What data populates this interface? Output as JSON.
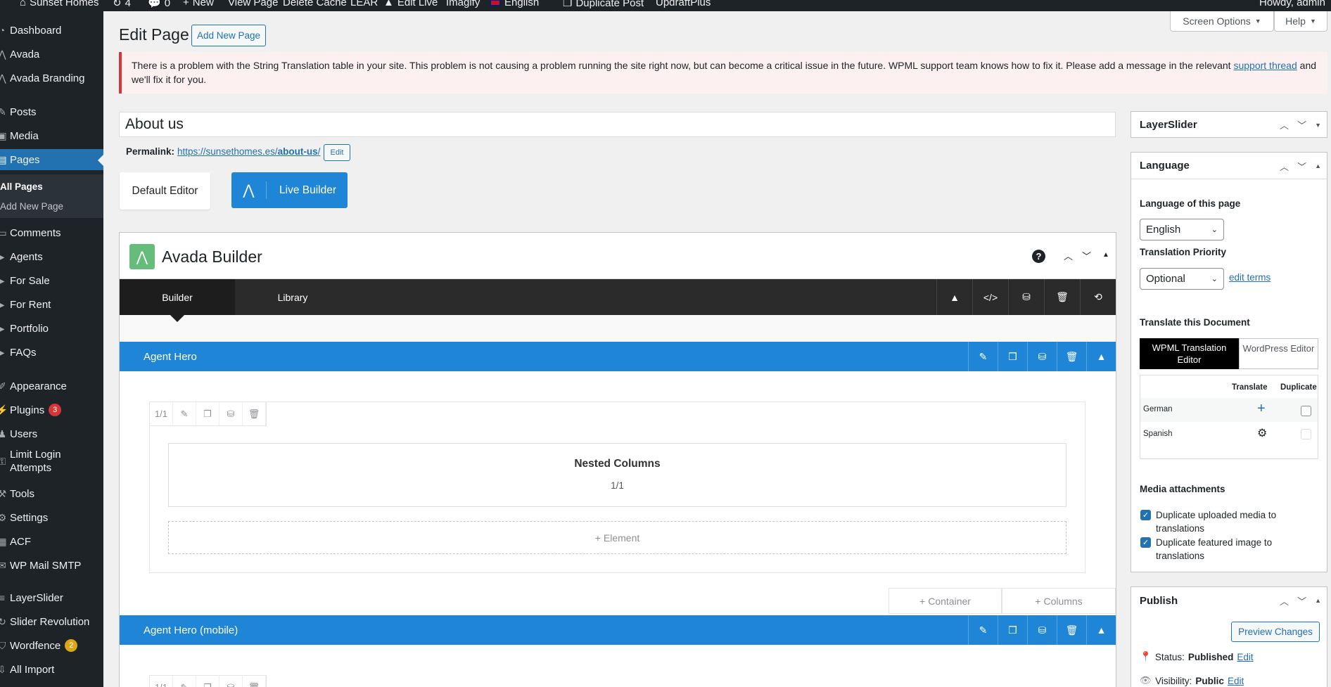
{
  "admin_bar": {
    "site_name": "Sunset Homes",
    "updates": "4",
    "comments": "0",
    "new": "New",
    "view_page": "View Page",
    "delete_cache": "Delete Cache",
    "lear": "LEAR",
    "edit_live": "Edit Live",
    "imagify": "Imagify",
    "language": "English",
    "duplicate_post": "Duplicate Post",
    "updraftplus": "UpdraftPlus",
    "howdy": "Howdy, admin"
  },
  "sidebar": {
    "items": [
      {
        "label": "Dashboard",
        "icon": "dashboard-icon"
      },
      {
        "label": "Avada",
        "icon": "avada-icon"
      },
      {
        "label": "Avada Branding",
        "icon": "avada-icon"
      },
      {
        "label": "Posts",
        "icon": "pin-icon"
      },
      {
        "label": "Media",
        "icon": "media-icon"
      },
      {
        "label": "Pages",
        "icon": "page-icon"
      },
      {
        "label": "Comments",
        "icon": "comment-icon"
      },
      {
        "label": "Agents",
        "icon": "generic-icon"
      },
      {
        "label": "For Sale",
        "icon": "generic-icon"
      },
      {
        "label": "For Rent",
        "icon": "generic-icon"
      },
      {
        "label": "Portfolio",
        "icon": "generic-icon"
      },
      {
        "label": "FAQs",
        "icon": "generic-icon"
      },
      {
        "label": "Appearance",
        "icon": "brush-icon"
      },
      {
        "label": "Plugins",
        "icon": "plugin-icon",
        "badge": "3"
      },
      {
        "label": "Users",
        "icon": "users-icon"
      },
      {
        "label": "Limit Login",
        "label2": "Attempts",
        "icon": "lock-icon"
      },
      {
        "label": "Tools",
        "icon": "wrench-icon"
      },
      {
        "label": "Settings",
        "icon": "settings-icon"
      },
      {
        "label": "ACF",
        "icon": "grid-icon"
      },
      {
        "label": "WP Mail SMTP",
        "icon": "mail-icon"
      },
      {
        "label": "LayerSlider",
        "icon": "layers-icon"
      },
      {
        "label": "Slider Revolution",
        "icon": "refresh-icon"
      },
      {
        "label": "Wordfence",
        "icon": "shield-icon",
        "badge": "2"
      },
      {
        "label": "All Import",
        "icon": "import-icon"
      }
    ],
    "submenu": [
      "All Pages",
      "Add New Page"
    ]
  },
  "top_buttons": {
    "screen_options": "Screen Options",
    "help": "Help"
  },
  "page": {
    "title": "Edit Page",
    "add_new": "Add New Page",
    "post_title": "About us",
    "permalink_label": "Permalink:",
    "permalink_base": "https://sunsethomes.es/",
    "permalink_slug": "about-us",
    "permalink_tail": "/",
    "permalink_edit": "Edit",
    "default_editor": "Default Editor",
    "live_builder": "Live Builder"
  },
  "notice": {
    "text_before": "There is a problem with the String Translation table in your site. This problem is not causing a problem running the site right now, but can become a critical issue in the future. WPML support team knows how to fix it. Please add a message in the relevant ",
    "link": "support thread",
    "text_after": " and we'll fix it for you."
  },
  "builder": {
    "title": "Avada Builder",
    "tab_builder": "Builder",
    "tab_library": "Library",
    "container1": "Agent Hero",
    "container2": "Agent Hero (mobile)",
    "col_size": "1/1",
    "nested_title": "Nested Columns",
    "nested_size": "1/1",
    "add_element": "Element",
    "add_container": "Container",
    "add_columns": "Columns"
  },
  "layerslider_box": {
    "title": "LayerSlider"
  },
  "language_box": {
    "title": "Language",
    "lang_label": "Language of this page",
    "lang_value": "English",
    "priority_label": "Translation Priority",
    "priority_value": "Optional",
    "edit_terms": "edit terms",
    "translate_doc": "Translate this Document",
    "wpml_editor": "WPML Translation Editor",
    "wp_editor": "WordPress Editor",
    "col_translate": "Translate",
    "col_duplicate": "Duplicate",
    "lang1": "German",
    "lang2": "Spanish",
    "media_title": "Media attachments",
    "dup_media": "Duplicate uploaded media to translations",
    "dup_featured": "Duplicate featured image to translations"
  },
  "publish_box": {
    "title": "Publish",
    "preview": "Preview Changes",
    "status_label": "Status:",
    "status_value": "Published",
    "status_edit": "Edit",
    "visibility_label": "Visibility:",
    "visibility_value": "Public",
    "visibility_edit": "Edit"
  }
}
